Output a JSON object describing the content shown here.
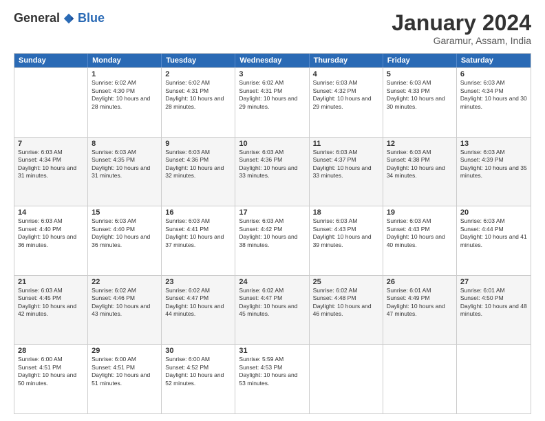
{
  "logo": {
    "general": "General",
    "blue": "Blue"
  },
  "header": {
    "month": "January 2024",
    "location": "Garamur, Assam, India"
  },
  "weekdays": [
    "Sunday",
    "Monday",
    "Tuesday",
    "Wednesday",
    "Thursday",
    "Friday",
    "Saturday"
  ],
  "rows": [
    [
      {
        "day": "",
        "sunrise": "",
        "sunset": "",
        "daylight": ""
      },
      {
        "day": "1",
        "sunrise": "Sunrise: 6:02 AM",
        "sunset": "Sunset: 4:30 PM",
        "daylight": "Daylight: 10 hours and 28 minutes."
      },
      {
        "day": "2",
        "sunrise": "Sunrise: 6:02 AM",
        "sunset": "Sunset: 4:31 PM",
        "daylight": "Daylight: 10 hours and 28 minutes."
      },
      {
        "day": "3",
        "sunrise": "Sunrise: 6:02 AM",
        "sunset": "Sunset: 4:31 PM",
        "daylight": "Daylight: 10 hours and 29 minutes."
      },
      {
        "day": "4",
        "sunrise": "Sunrise: 6:03 AM",
        "sunset": "Sunset: 4:32 PM",
        "daylight": "Daylight: 10 hours and 29 minutes."
      },
      {
        "day": "5",
        "sunrise": "Sunrise: 6:03 AM",
        "sunset": "Sunset: 4:33 PM",
        "daylight": "Daylight: 10 hours and 30 minutes."
      },
      {
        "day": "6",
        "sunrise": "Sunrise: 6:03 AM",
        "sunset": "Sunset: 4:34 PM",
        "daylight": "Daylight: 10 hours and 30 minutes."
      }
    ],
    [
      {
        "day": "7",
        "sunrise": "Sunrise: 6:03 AM",
        "sunset": "Sunset: 4:34 PM",
        "daylight": "Daylight: 10 hours and 31 minutes."
      },
      {
        "day": "8",
        "sunrise": "Sunrise: 6:03 AM",
        "sunset": "Sunset: 4:35 PM",
        "daylight": "Daylight: 10 hours and 31 minutes."
      },
      {
        "day": "9",
        "sunrise": "Sunrise: 6:03 AM",
        "sunset": "Sunset: 4:36 PM",
        "daylight": "Daylight: 10 hours and 32 minutes."
      },
      {
        "day": "10",
        "sunrise": "Sunrise: 6:03 AM",
        "sunset": "Sunset: 4:36 PM",
        "daylight": "Daylight: 10 hours and 33 minutes."
      },
      {
        "day": "11",
        "sunrise": "Sunrise: 6:03 AM",
        "sunset": "Sunset: 4:37 PM",
        "daylight": "Daylight: 10 hours and 33 minutes."
      },
      {
        "day": "12",
        "sunrise": "Sunrise: 6:03 AM",
        "sunset": "Sunset: 4:38 PM",
        "daylight": "Daylight: 10 hours and 34 minutes."
      },
      {
        "day": "13",
        "sunrise": "Sunrise: 6:03 AM",
        "sunset": "Sunset: 4:39 PM",
        "daylight": "Daylight: 10 hours and 35 minutes."
      }
    ],
    [
      {
        "day": "14",
        "sunrise": "Sunrise: 6:03 AM",
        "sunset": "Sunset: 4:40 PM",
        "daylight": "Daylight: 10 hours and 36 minutes."
      },
      {
        "day": "15",
        "sunrise": "Sunrise: 6:03 AM",
        "sunset": "Sunset: 4:40 PM",
        "daylight": "Daylight: 10 hours and 36 minutes."
      },
      {
        "day": "16",
        "sunrise": "Sunrise: 6:03 AM",
        "sunset": "Sunset: 4:41 PM",
        "daylight": "Daylight: 10 hours and 37 minutes."
      },
      {
        "day": "17",
        "sunrise": "Sunrise: 6:03 AM",
        "sunset": "Sunset: 4:42 PM",
        "daylight": "Daylight: 10 hours and 38 minutes."
      },
      {
        "day": "18",
        "sunrise": "Sunrise: 6:03 AM",
        "sunset": "Sunset: 4:43 PM",
        "daylight": "Daylight: 10 hours and 39 minutes."
      },
      {
        "day": "19",
        "sunrise": "Sunrise: 6:03 AM",
        "sunset": "Sunset: 4:43 PM",
        "daylight": "Daylight: 10 hours and 40 minutes."
      },
      {
        "day": "20",
        "sunrise": "Sunrise: 6:03 AM",
        "sunset": "Sunset: 4:44 PM",
        "daylight": "Daylight: 10 hours and 41 minutes."
      }
    ],
    [
      {
        "day": "21",
        "sunrise": "Sunrise: 6:03 AM",
        "sunset": "Sunset: 4:45 PM",
        "daylight": "Daylight: 10 hours and 42 minutes."
      },
      {
        "day": "22",
        "sunrise": "Sunrise: 6:02 AM",
        "sunset": "Sunset: 4:46 PM",
        "daylight": "Daylight: 10 hours and 43 minutes."
      },
      {
        "day": "23",
        "sunrise": "Sunrise: 6:02 AM",
        "sunset": "Sunset: 4:47 PM",
        "daylight": "Daylight: 10 hours and 44 minutes."
      },
      {
        "day": "24",
        "sunrise": "Sunrise: 6:02 AM",
        "sunset": "Sunset: 4:47 PM",
        "daylight": "Daylight: 10 hours and 45 minutes."
      },
      {
        "day": "25",
        "sunrise": "Sunrise: 6:02 AM",
        "sunset": "Sunset: 4:48 PM",
        "daylight": "Daylight: 10 hours and 46 minutes."
      },
      {
        "day": "26",
        "sunrise": "Sunrise: 6:01 AM",
        "sunset": "Sunset: 4:49 PM",
        "daylight": "Daylight: 10 hours and 47 minutes."
      },
      {
        "day": "27",
        "sunrise": "Sunrise: 6:01 AM",
        "sunset": "Sunset: 4:50 PM",
        "daylight": "Daylight: 10 hours and 48 minutes."
      }
    ],
    [
      {
        "day": "28",
        "sunrise": "Sunrise: 6:00 AM",
        "sunset": "Sunset: 4:51 PM",
        "daylight": "Daylight: 10 hours and 50 minutes."
      },
      {
        "day": "29",
        "sunrise": "Sunrise: 6:00 AM",
        "sunset": "Sunset: 4:51 PM",
        "daylight": "Daylight: 10 hours and 51 minutes."
      },
      {
        "day": "30",
        "sunrise": "Sunrise: 6:00 AM",
        "sunset": "Sunset: 4:52 PM",
        "daylight": "Daylight: 10 hours and 52 minutes."
      },
      {
        "day": "31",
        "sunrise": "Sunrise: 5:59 AM",
        "sunset": "Sunset: 4:53 PM",
        "daylight": "Daylight: 10 hours and 53 minutes."
      },
      {
        "day": "",
        "sunrise": "",
        "sunset": "",
        "daylight": ""
      },
      {
        "day": "",
        "sunrise": "",
        "sunset": "",
        "daylight": ""
      },
      {
        "day": "",
        "sunrise": "",
        "sunset": "",
        "daylight": ""
      }
    ]
  ]
}
